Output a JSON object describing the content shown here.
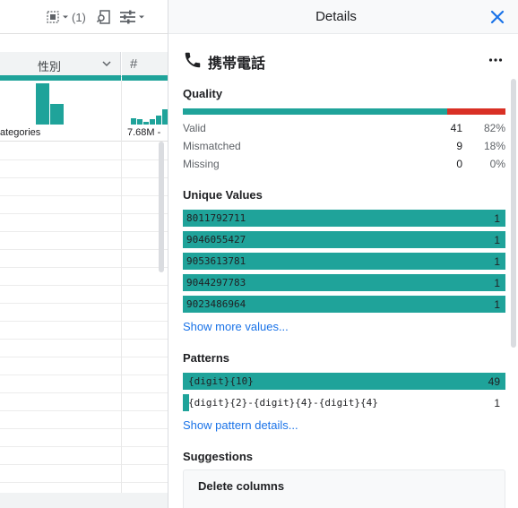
{
  "colors": {
    "teal": "#1fa39a",
    "mismatch": "#d93025",
    "link": "#1a73e8"
  },
  "toolbar": {
    "selector_icon": "column-selector-icon",
    "count_label": "(1)",
    "search_icon": "find-icon",
    "settings_icon": "tune-icon"
  },
  "grid": {
    "gender_column": {
      "name": "性別",
      "histogram_label": "ategories",
      "bar_levels": [
        1.0,
        0.5
      ]
    },
    "phone_column": {
      "type_icon": "#",
      "histogram_label": "7.68M -",
      "bar_levels": [
        0.3,
        0.25,
        0.15,
        0.25,
        0.45,
        0.75
      ]
    }
  },
  "panel": {
    "title": "Details",
    "column_title": "携帯電話",
    "quality": {
      "heading": "Quality",
      "valid_fraction": 0.82,
      "rows": [
        {
          "label": "Valid",
          "count": "41",
          "percent": "82%"
        },
        {
          "label": "Mismatched",
          "count": "9",
          "percent": "18%"
        },
        {
          "label": "Missing",
          "count": "0",
          "percent": "0%"
        }
      ]
    },
    "unique_values": {
      "heading": "Unique Values",
      "rows": [
        {
          "value": "8011792711",
          "count": "1"
        },
        {
          "value": "9046055427",
          "count": "1"
        },
        {
          "value": "9053613781",
          "count": "1"
        },
        {
          "value": "9044297783",
          "count": "1"
        },
        {
          "value": "9023486964",
          "count": "1"
        }
      ],
      "more_link": "Show more values..."
    },
    "patterns": {
      "heading": "Patterns",
      "rows": [
        {
          "value": "{digit}{10}",
          "count": "49",
          "fraction": 1.0
        },
        {
          "value": "{digit}{2}-{digit}{4}-{digit}{4}",
          "count": "1",
          "fraction": 0.02
        }
      ],
      "details_link": "Show pattern details..."
    },
    "suggestions": {
      "heading": "Suggestions",
      "card_title": "Delete columns"
    }
  }
}
